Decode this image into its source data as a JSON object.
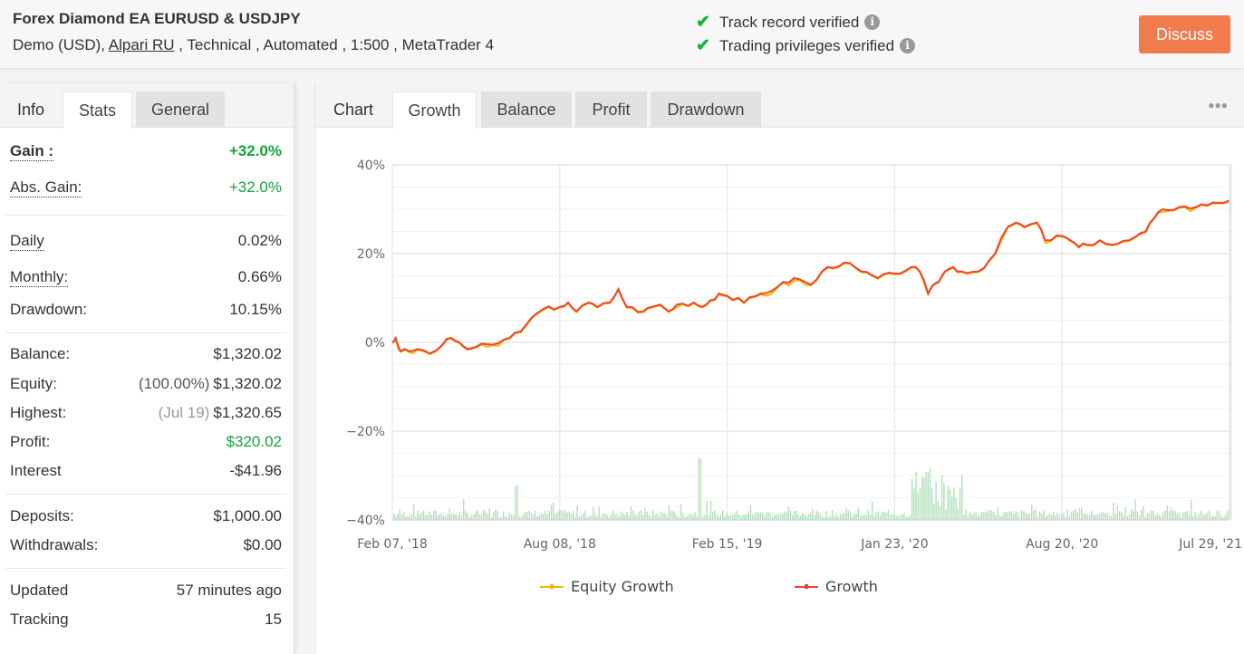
{
  "header": {
    "title": "Forex Diamond EA EURUSD & USDJPY",
    "subtitle_prefix": "Demo (USD), ",
    "broker": "Alpari RU",
    "subtitle_suffix": " , Technical , Automated , 1:500 , MetaTrader 4",
    "verifications": [
      {
        "label": "Track record verified",
        "icon": "check-icon"
      },
      {
        "label": "Trading privileges verified",
        "icon": "check-icon"
      }
    ],
    "info_glyph": "i",
    "check_glyph": "✔",
    "discuss_label": "Discuss",
    "discuss_color": "#f07b4d"
  },
  "left_tabs": [
    {
      "label": "Info"
    },
    {
      "label": "Stats",
      "active": true
    },
    {
      "label": "General"
    }
  ],
  "stats": {
    "gain": {
      "label": "Gain :",
      "value": "+32.0%"
    },
    "abs_gain": {
      "label": "Abs. Gain:",
      "value": "+32.0%"
    },
    "daily": {
      "label": "Daily",
      "value": "0.02%"
    },
    "monthly": {
      "label": "Monthly:",
      "value": "0.66%"
    },
    "drawdown": {
      "label": "Drawdown:",
      "value": "10.15%"
    },
    "balance": {
      "label": "Balance:",
      "value": "$1,320.02"
    },
    "equity": {
      "label": "Equity:",
      "note": "(100.00%)",
      "value": "$1,320.02"
    },
    "highest": {
      "label": "Highest:",
      "note": "(Jul 19)",
      "value": "$1,320.65"
    },
    "profit": {
      "label": "Profit:",
      "value": "$320.02"
    },
    "interest": {
      "label": "Interest",
      "value": "-$41.96"
    },
    "deposits": {
      "label": "Deposits:",
      "value": "$1,000.00"
    },
    "withdrawals": {
      "label": "Withdrawals:",
      "value": "$0.00"
    },
    "updated": {
      "label": "Updated",
      "value": "57 minutes ago"
    },
    "tracking": {
      "label": "Tracking",
      "value": "15"
    }
  },
  "colors": {
    "positive": "#13a538",
    "growth": "#ee4433",
    "equity_growth": "#f5b800",
    "volume_bars": "#b3e0b8"
  },
  "chart_tabs": [
    {
      "label": "Chart"
    },
    {
      "label": "Growth",
      "active": true
    },
    {
      "label": "Balance"
    },
    {
      "label": "Profit"
    },
    {
      "label": "Drawdown"
    }
  ],
  "more_glyph": "●●●",
  "chart_data": {
    "type": "line",
    "title": "",
    "xlabel": "",
    "ylabel": "",
    "ylim": [
      -40,
      40
    ],
    "yticks": [
      "40%",
      "20%",
      "0%",
      "−20%",
      "−40%"
    ],
    "ytick_values": [
      40,
      20,
      0,
      -20,
      -40
    ],
    "xticks": [
      "Feb 07, '18",
      "Aug 08, '18",
      "Feb 15, '19",
      "Jan 23, '20",
      "Aug 20, '20",
      "Jul 29, '21"
    ],
    "grid": true,
    "legend_position": "bottom",
    "series": [
      {
        "name": "Growth",
        "color": "#ee4433",
        "x_fraction": [
          0,
          0.004,
          0.01,
          0.02,
          0.03,
          0.045,
          0.06,
          0.07,
          0.08,
          0.09,
          0.1,
          0.12,
          0.14,
          0.16,
          0.18,
          0.2,
          0.21,
          0.22,
          0.235,
          0.245,
          0.26,
          0.27,
          0.28,
          0.3,
          0.31,
          0.32,
          0.33,
          0.34,
          0.36,
          0.37,
          0.38,
          0.39,
          0.4,
          0.42,
          0.44,
          0.46,
          0.48,
          0.5,
          0.52,
          0.54,
          0.56,
          0.58,
          0.6,
          0.62,
          0.63,
          0.64,
          0.65,
          0.655,
          0.66,
          0.67,
          0.68,
          0.7,
          0.72,
          0.735,
          0.745,
          0.755,
          0.77,
          0.78,
          0.8,
          0.81,
          0.82,
          0.83,
          0.845,
          0.86,
          0.88,
          0.9,
          0.91,
          0.92,
          0.94,
          0.96,
          0.98,
          1.0
        ],
        "values": [
          0,
          1,
          -2,
          -2,
          -1.5,
          -2.5,
          -0.5,
          1,
          0,
          -1.5,
          -1,
          -0.5,
          1,
          4,
          7.5,
          8,
          9,
          7,
          9,
          8,
          9,
          12,
          8,
          7,
          8,
          8.5,
          7,
          8.5,
          9,
          8,
          9.5,
          11,
          10.5,
          9,
          11,
          12.5,
          14.5,
          13,
          17,
          18,
          16,
          14.5,
          15.5,
          17,
          16,
          11,
          13.5,
          14.5,
          16,
          17,
          16,
          16,
          20,
          26,
          27,
          26,
          27,
          23,
          24,
          23,
          21.5,
          22,
          23,
          22,
          23,
          25,
          28,
          30,
          30.5,
          30.5,
          31.5,
          32
        ]
      },
      {
        "name": "Equity Growth",
        "color": "#f5b800",
        "note": "tracks Growth closely with small deviations",
        "values_same_as": "Growth"
      },
      {
        "name": "Volume",
        "type": "bar",
        "color": "#b3e0b8",
        "note": "daily activity bars along the -40% baseline; spike cluster around Feb-Apr 2020"
      }
    ]
  },
  "legend": [
    {
      "label": "Equity Growth",
      "color": "#f5b800"
    },
    {
      "label": "Growth",
      "color": "#ee4433"
    }
  ]
}
